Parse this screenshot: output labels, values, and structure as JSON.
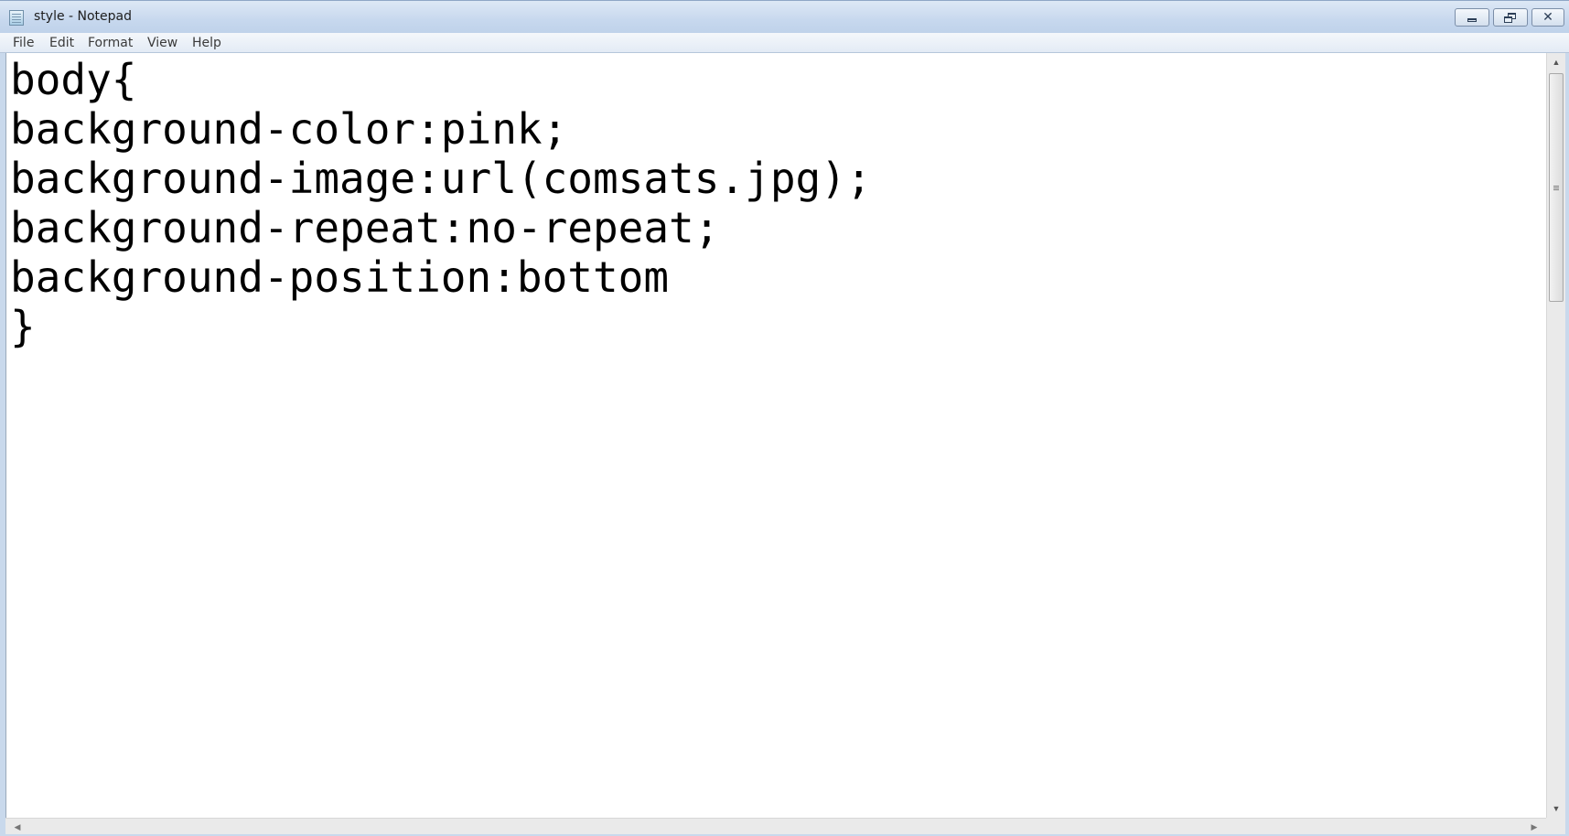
{
  "window": {
    "title": "style - Notepad",
    "minimize_label": "minimize",
    "maximize_label": "restore",
    "close_label": "close"
  },
  "menubar": {
    "items": [
      {
        "label": "File"
      },
      {
        "label": "Edit"
      },
      {
        "label": "Format"
      },
      {
        "label": "View"
      },
      {
        "label": "Help"
      }
    ]
  },
  "editor": {
    "content": "body{\nbackground-color:pink;\nbackground-image:url(comsats.jpg);\nbackground-repeat:no-repeat;\nbackground-position:bottom\n}"
  },
  "icons": {
    "app": "notepad-icon",
    "scroll_up": "arrow-up-icon",
    "scroll_down": "arrow-down-icon",
    "scroll_left": "arrow-left-icon",
    "scroll_right": "arrow-right-icon"
  },
  "colors": {
    "titlebar": "#c7d8ee",
    "editor_background": "#ffffff",
    "text": "#000000"
  }
}
